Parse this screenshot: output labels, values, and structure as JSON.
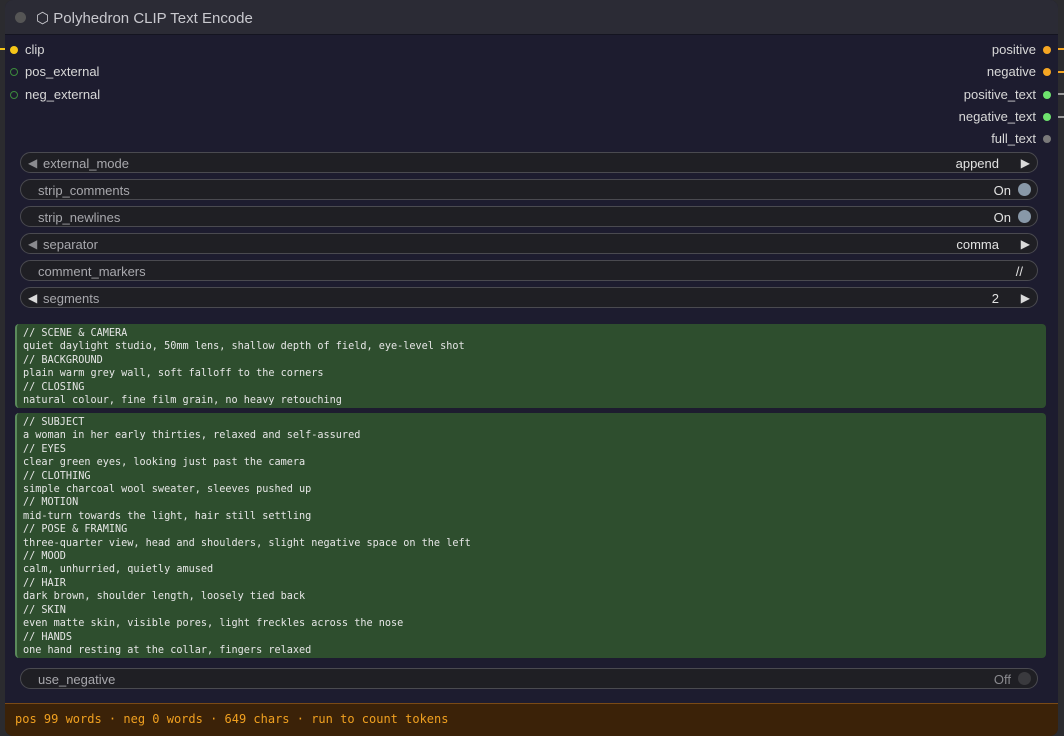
{
  "node": {
    "title": "⬡ Polyhedron CLIP Text Encode"
  },
  "inputs": [
    {
      "label": "clip",
      "color": "#f5c518"
    },
    {
      "label": "pos_external",
      "color": "#3c8a3c"
    },
    {
      "label": "neg_external",
      "color": "#3c8a3c"
    }
  ],
  "outputs": [
    {
      "label": "positive",
      "color": "#f5a623"
    },
    {
      "label": "negative",
      "color": "#f5a623"
    },
    {
      "label": "positive_text",
      "color": "#6ee36e"
    },
    {
      "label": "negative_text",
      "color": "#6ee36e"
    },
    {
      "label": "full_text",
      "color": "#7a7a7a"
    }
  ],
  "widgets": {
    "external_mode": {
      "label": "external_mode",
      "value": "append"
    },
    "strip_comments": {
      "label": "strip_comments",
      "value": "On"
    },
    "strip_newlines": {
      "label": "strip_newlines",
      "value": "On"
    },
    "separator": {
      "label": "separator",
      "value": "comma"
    },
    "comment_markers": {
      "label": "comment_markers",
      "value": "//"
    },
    "segments": {
      "label": "segments",
      "value": "2"
    },
    "use_negative": {
      "label": "use_negative",
      "value": "Off"
    }
  },
  "segment1_lines": [
    "// SCENE & CAMERA",
    "quiet daylight studio, 50mm lens, shallow depth of field, eye-level shot",
    "// BACKGROUND",
    "plain warm grey wall, soft falloff to the corners",
    "// CLOSING",
    "natural colour, fine film grain, no heavy retouching"
  ],
  "segment2_lines": [
    "// SUBJECT",
    "a woman in her early thirties, relaxed and self-assured",
    "// EYES",
    "clear green eyes, looking just past the camera",
    "// CLOTHING",
    "simple charcoal wool sweater, sleeves pushed up",
    "// MOTION",
    "mid-turn towards the light, hair still settling",
    "// POSE & FRAMING",
    "three-quarter view, head and shoulders, slight negative space on the left",
    "// MOOD",
    "calm, unhurried, quietly amused",
    "// HAIR",
    "dark brown, shoulder length, loosely tied back",
    "// SKIN",
    "even matte skin, visible pores, light freckles across the nose",
    "// HANDS",
    "one hand resting at the collar, fingers relaxed"
  ],
  "footer": {
    "stats": "pos 99 words · neg 0 words · 649 chars · run to count tokens"
  },
  "colors": {
    "accent_orange": "#f0a020",
    "textbox_bg": "#2e4e2e",
    "node_bg": "#1d1c2f"
  }
}
